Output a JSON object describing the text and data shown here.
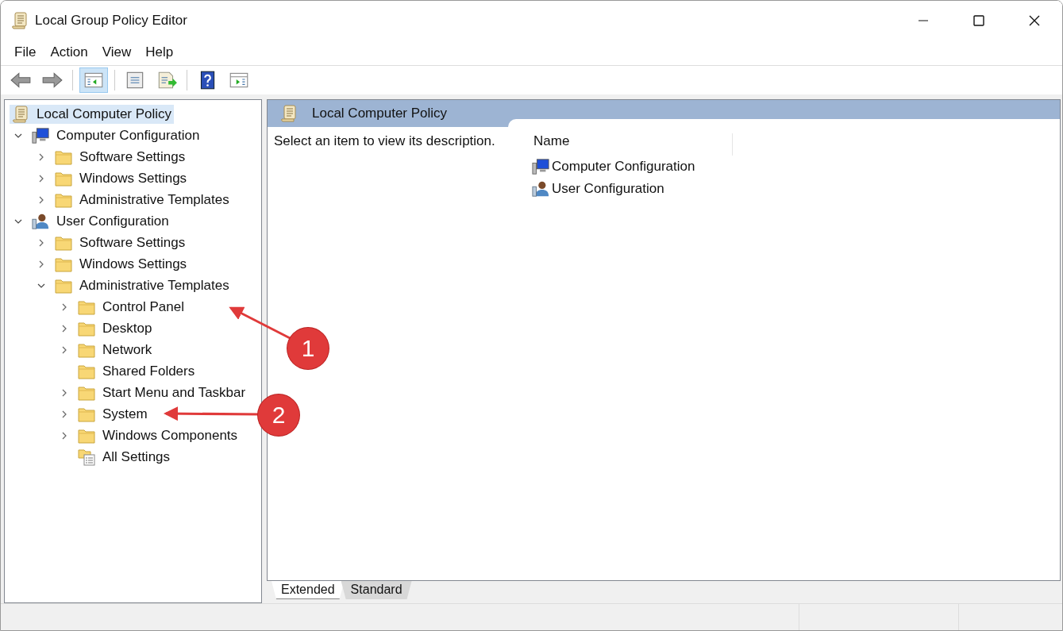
{
  "window": {
    "title": "Local Group Policy Editor"
  },
  "menu": [
    "File",
    "Action",
    "View",
    "Help"
  ],
  "tree": [
    {
      "label": "Local Computer Policy",
      "kind": "policy",
      "selected": true,
      "children": [
        {
          "label": "Computer Configuration",
          "kind": "computer",
          "selected": false,
          "expanded": true,
          "children": [
            {
              "label": "Software Settings",
              "kind": "folder",
              "selected": false,
              "expanded": false,
              "has_children": true
            },
            {
              "label": "Windows Settings",
              "kind": "folder",
              "selected": false,
              "expanded": false,
              "has_children": true
            },
            {
              "label": "Administrative Templates",
              "kind": "folder",
              "selected": false,
              "expanded": false,
              "has_children": true
            }
          ]
        },
        {
          "label": "User Configuration",
          "kind": "user",
          "selected": false,
          "expanded": true,
          "children": [
            {
              "label": "Software Settings",
              "kind": "folder",
              "selected": false,
              "expanded": false,
              "has_children": true
            },
            {
              "label": "Windows Settings",
              "kind": "folder",
              "selected": false,
              "expanded": false,
              "has_children": true
            },
            {
              "label": "Administrative Templates",
              "kind": "folder",
              "selected": false,
              "expanded": true,
              "children": [
                {
                  "label": "Control Panel",
                  "kind": "folder",
                  "selected": false,
                  "expanded": false,
                  "has_children": true
                },
                {
                  "label": "Desktop",
                  "kind": "folder",
                  "selected": false,
                  "expanded": false,
                  "has_children": true
                },
                {
                  "label": "Network",
                  "kind": "folder",
                  "selected": false,
                  "expanded": false,
                  "has_children": true
                },
                {
                  "label": "Shared Folders",
                  "kind": "folder",
                  "selected": false,
                  "expanded": false,
                  "has_children": false
                },
                {
                  "label": "Start Menu and Taskbar",
                  "kind": "folder",
                  "selected": false,
                  "expanded": false,
                  "has_children": true
                },
                {
                  "label": "System",
                  "kind": "folder",
                  "selected": false,
                  "expanded": false,
                  "has_children": true
                },
                {
                  "label": "Windows Components",
                  "kind": "folder",
                  "selected": false,
                  "expanded": false,
                  "has_children": true
                },
                {
                  "label": "All Settings",
                  "kind": "settings",
                  "selected": false,
                  "expanded": false,
                  "has_children": false
                }
              ]
            }
          ]
        }
      ]
    }
  ],
  "details": {
    "header": "Local Computer Policy",
    "description": "Select an item to view its description.",
    "column": "Name",
    "items": [
      {
        "label": "Computer Configuration",
        "kind": "computer"
      },
      {
        "label": "User Configuration",
        "kind": "user"
      }
    ]
  },
  "view_tabs": [
    {
      "label": "Extended",
      "selected": true
    },
    {
      "label": "Standard",
      "selected": false
    }
  ],
  "callouts": [
    "1",
    "2"
  ]
}
